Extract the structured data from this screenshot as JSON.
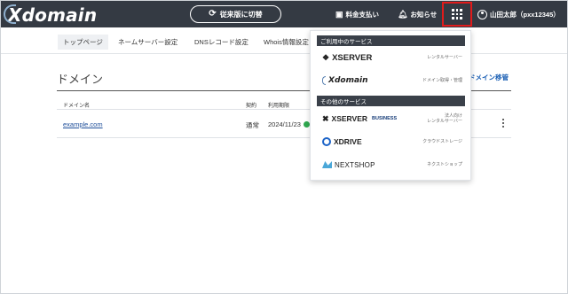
{
  "header": {
    "logo": "Xdomain",
    "switch_label": "従来版に切替",
    "billing_label": "料金支払い",
    "news_label": "お知らせ",
    "user_label": "山田太郎（pxx12345）",
    "grid_highlight_color": "#e01b1b",
    "bg_color": "#343a43"
  },
  "subnav": {
    "tabs": [
      {
        "label": "トップページ",
        "active": true
      },
      {
        "label": "ネームサーバー設定",
        "active": false
      },
      {
        "label": "DNSレコード設定",
        "active": false
      },
      {
        "label": "Whois情報設定",
        "active": false
      }
    ]
  },
  "main": {
    "title": "ドメイン",
    "transfer_link": "ドメイン移管",
    "columns": [
      "ドメイン名",
      "契約",
      "利用期限"
    ],
    "rows": [
      {
        "domain": "example.com",
        "contract": "通常",
        "expiry": "2024/11/23"
      }
    ]
  },
  "menu": {
    "section_in_use": "ご利用中のサービス",
    "section_other": "その他のサービス",
    "services": [
      {
        "name": "XSERVER",
        "desc": "レンタルサーバー"
      },
      {
        "name": "Xdomain",
        "desc": "ドメイン取得・管理"
      },
      {
        "name": "XSERVER",
        "badge": "BUSINESS",
        "desc_line1": "法人向け",
        "desc_line2": "レンタルサーバー"
      },
      {
        "name": "XDRIVE",
        "desc": "クラウドストレージ"
      },
      {
        "name": "NEXTSHOP",
        "desc": "ネクストショップ"
      }
    ]
  },
  "icons": {
    "switch": "sync-icon",
    "billing": "invoice-icon",
    "news": "bell-icon",
    "apps": "grid-icon",
    "user": "user-icon",
    "row_menu": "kebab-icon"
  }
}
